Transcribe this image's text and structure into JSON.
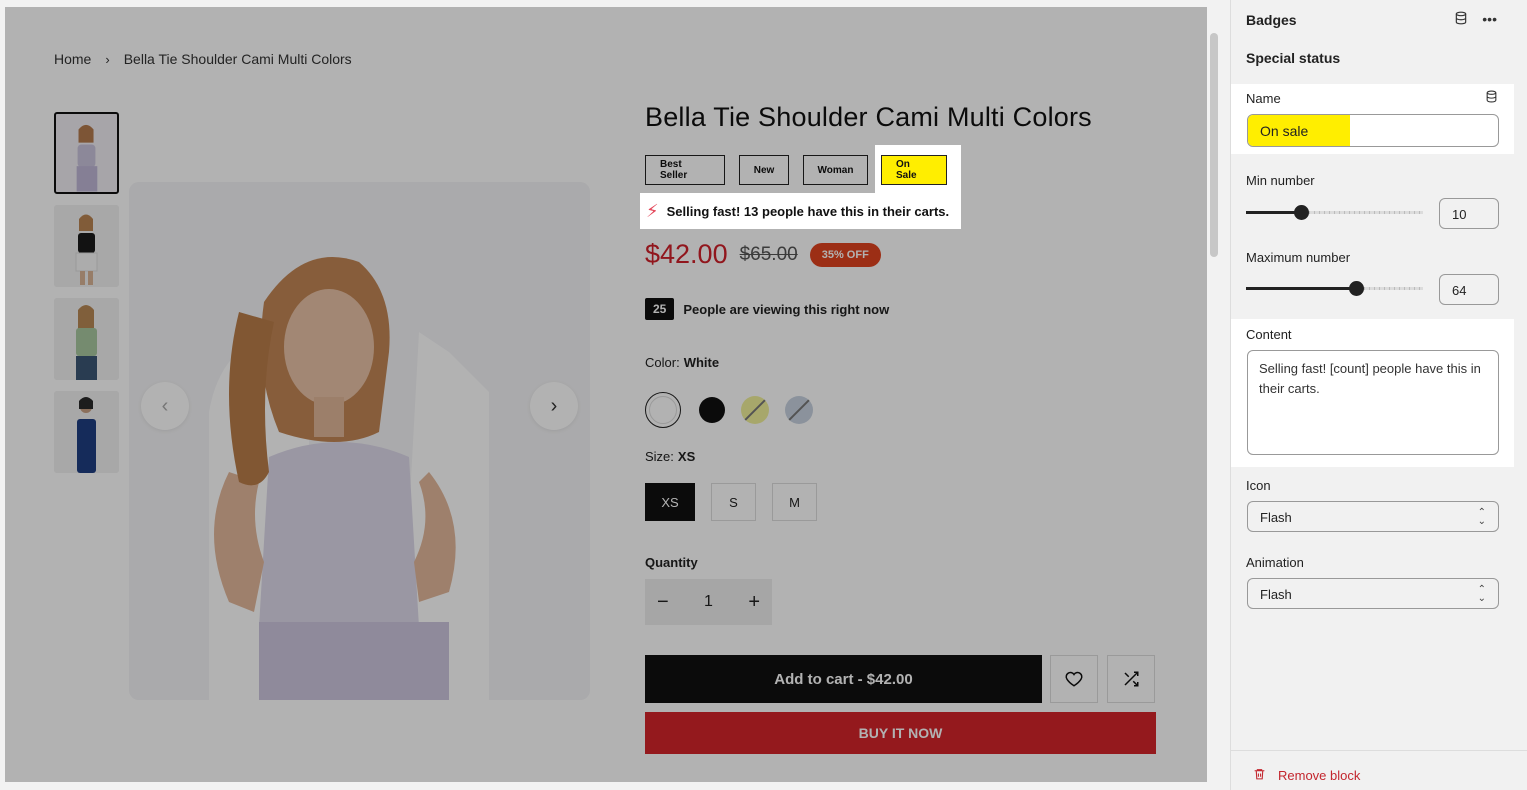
{
  "breadcrumb": {
    "home": "Home",
    "separator": "›",
    "current": "Bella Tie Shoulder Cami Multi Colors"
  },
  "product": {
    "title": "Bella Tie Shoulder Cami Multi Colors",
    "badges": [
      "Best Seller",
      "New",
      "Woman",
      "On Sale"
    ],
    "selling_fast": "Selling fast! 13 people have this in their carts.",
    "price_now": "$42.00",
    "price_old": "$65.00",
    "discount": "35% OFF",
    "viewers_count": "25",
    "viewers_text": "People are viewing this right now",
    "color_label": "Color:",
    "color_value": "White",
    "colors": [
      "#ffffff",
      "#111111",
      "#f0f09a",
      "#c7d2e0"
    ],
    "size_label": "Size:",
    "size_value": "XS",
    "sizes": [
      "XS",
      "S",
      "M"
    ],
    "quantity_label": "Quantity",
    "quantity": "1",
    "qty_minus": "−",
    "qty_plus": "+",
    "add_to_cart": "Add to cart - $42.00",
    "buy_now": "BUY IT NOW"
  },
  "icons": {
    "wishlist": "heart-icon",
    "compare": "shuffle-icon",
    "prev": "chevron-left-icon",
    "next": "chevron-right-icon",
    "flash": "flash-icon",
    "database": "database-icon",
    "more": "more-horizontal-icon",
    "trash": "trash-icon",
    "select": "chevron-up-down-icon"
  },
  "panel": {
    "title": "Badges",
    "section": "Special status",
    "name_label": "Name",
    "name_value": "On sale",
    "min_label": "Min number",
    "min_value": "10",
    "min_fraction": 0.31,
    "max_label": "Maximum number",
    "max_value": "64",
    "max_fraction": 0.62,
    "content_label": "Content",
    "content_value": "Selling fast! [count] people have  this in their carts.",
    "icon_label": "Icon",
    "icon_value": "Flash",
    "animation_label": "Animation",
    "animation_value": "Flash",
    "remove_label": "Remove block"
  },
  "colors": {
    "accent_red": "#d4242a",
    "highlight_yellow": "#ffee00",
    "sale_badge": "#e0421f"
  }
}
